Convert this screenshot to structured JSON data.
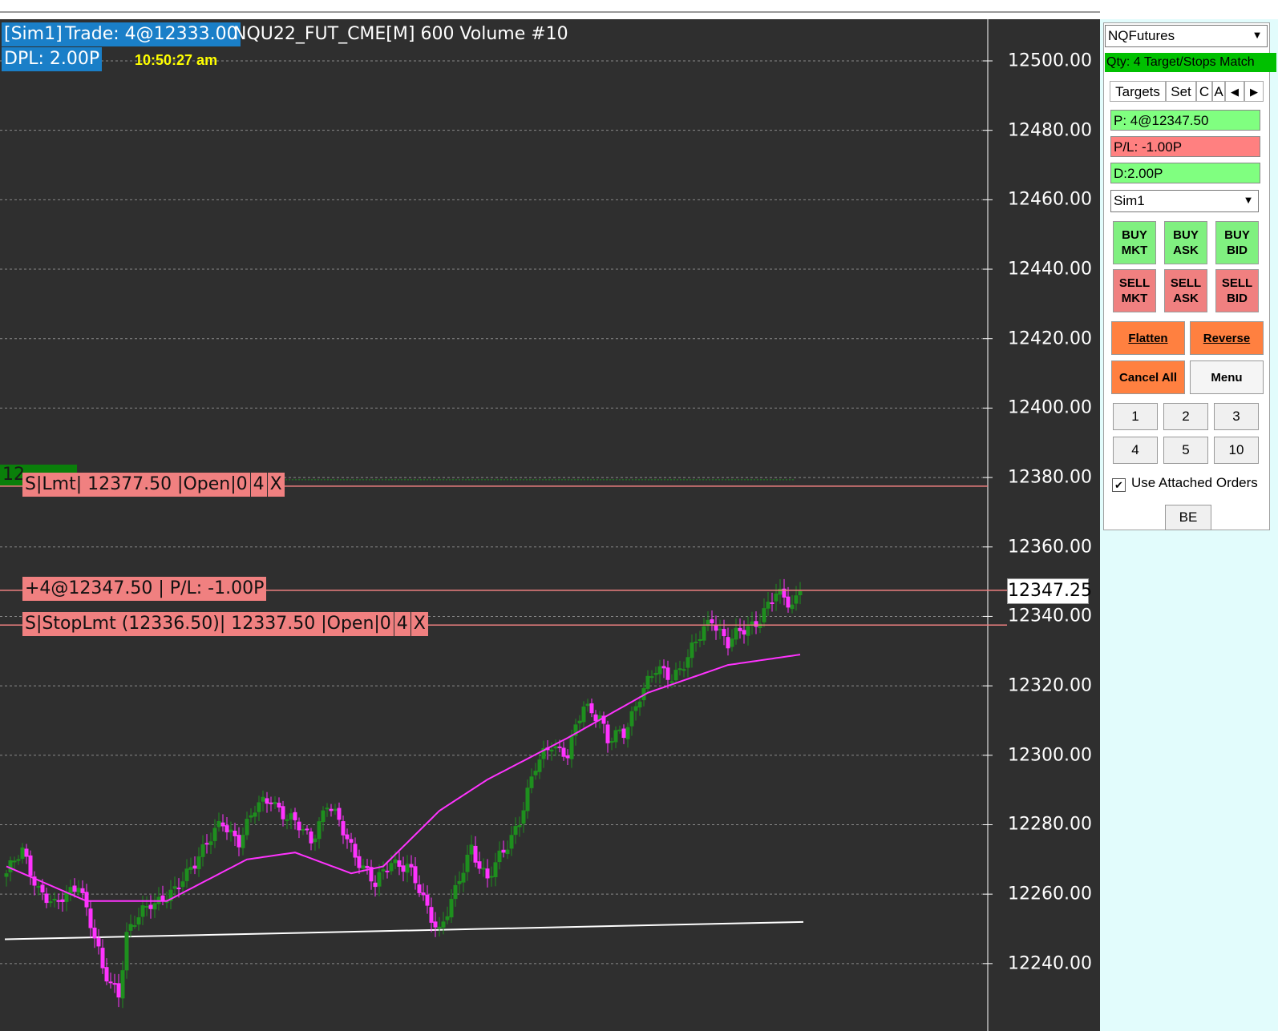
{
  "header": {
    "account": "[Sim1]",
    "trade": "Trade: 4@12333.00",
    "instrument_info": "NQU22_FUT_CME[M]  600 Volume  #10",
    "dpl": "DPL: 2.00P",
    "clock": "10:50:27 am"
  },
  "orders": {
    "limit_order": [
      "S|Lmt| 12377.50 |Open|0",
      "4",
      "X"
    ],
    "position": "+4@12347.50 | P/L: -1.00P",
    "stop_order": [
      "S|StopLmt (12336.50)| 12337.50 |Open|0",
      "4",
      "X"
    ],
    "truncated_marker": "12"
  },
  "axis": {
    "labels": [
      "12500.00",
      "12480.00",
      "12460.00",
      "12440.00",
      "12420.00",
      "12400.00",
      "12380.00",
      "12360.00",
      "12340.00",
      "12320.00",
      "12300.00",
      "12280.00",
      "12260.00",
      "12240.00"
    ],
    "last_price": "12347.25"
  },
  "panel": {
    "strategy": "NQFutures",
    "qty_status": "Qty: 4 Target/Stops Match",
    "tabs": [
      "Targets",
      "Set",
      "C",
      "A"
    ],
    "position_field": "P: 4@12347.50",
    "pl_field": "P/L: -1.00P",
    "d_field": "D:2.00P",
    "account": "Sim1",
    "buy_mkt": [
      "BUY",
      "MKT"
    ],
    "buy_ask": [
      "BUY",
      "ASK"
    ],
    "buy_bid": [
      "BUY",
      "BID"
    ],
    "sell_mkt": [
      "SELL",
      "MKT"
    ],
    "sell_ask": [
      "SELL",
      "ASK"
    ],
    "sell_bid": [
      "SELL",
      "BID"
    ],
    "flatten": "Flatten",
    "reverse": "Reverse",
    "cancel_all": "Cancel All",
    "menu": "Menu",
    "qty_buttons": [
      "1",
      "2",
      "3",
      "4",
      "5",
      "10"
    ],
    "use_attached_orders": "Use Attached Orders",
    "be": "BE"
  },
  "chart_data": {
    "type": "candlestick",
    "ylim": [
      12225,
      12515
    ],
    "grid": true,
    "gridlines": [
      12240,
      12260,
      12280,
      12300,
      12320,
      12340,
      12360,
      12380,
      12400,
      12420,
      12440,
      12460,
      12480,
      12500
    ],
    "order_lines": {
      "limit": 12377.5,
      "position": 12347.5,
      "stop": 12337.5
    },
    "colors": {
      "up": "#1e8f1e",
      "down": "#ff33ff",
      "ma": "#ff33ff",
      "trend": "#ffffff",
      "order_line": "#f08080",
      "background": "#2f2f2f"
    },
    "anchors": [
      [
        0,
        12266
      ],
      [
        4,
        12272
      ],
      [
        8,
        12262
      ],
      [
        12,
        12256
      ],
      [
        18,
        12264
      ],
      [
        24,
        12238
      ],
      [
        28,
        12232
      ],
      [
        30,
        12248
      ],
      [
        36,
        12258
      ],
      [
        42,
        12260
      ],
      [
        48,
        12272
      ],
      [
        54,
        12280
      ],
      [
        58,
        12276
      ],
      [
        62,
        12284
      ],
      [
        66,
        12288
      ],
      [
        70,
        12282
      ],
      [
        76,
        12276
      ],
      [
        80,
        12286
      ],
      [
        84,
        12278
      ],
      [
        88,
        12270
      ],
      [
        92,
        12262
      ],
      [
        96,
        12270
      ],
      [
        100,
        12268
      ],
      [
        104,
        12258
      ],
      [
        108,
        12250
      ],
      [
        112,
        12260
      ],
      [
        116,
        12274
      ],
      [
        120,
        12264
      ],
      [
        124,
        12272
      ],
      [
        128,
        12282
      ],
      [
        132,
        12296
      ],
      [
        136,
        12304
      ],
      [
        140,
        12300
      ],
      [
        144,
        12314
      ],
      [
        148,
        12312
      ],
      [
        150,
        12304
      ],
      [
        154,
        12306
      ],
      [
        158,
        12318
      ],
      [
        162,
        12324
      ],
      [
        166,
        12323
      ],
      [
        170,
        12328
      ],
      [
        174,
        12336
      ],
      [
        176,
        12340
      ],
      [
        180,
        12332
      ],
      [
        184,
        12336
      ],
      [
        188,
        12340
      ],
      [
        192,
        12346
      ],
      [
        196,
        12344
      ],
      [
        198,
        12347.25
      ]
    ],
    "ma_anchors": [
      [
        0,
        12268
      ],
      [
        20,
        12258
      ],
      [
        40,
        12258
      ],
      [
        60,
        12270
      ],
      [
        72,
        12272
      ],
      [
        86,
        12266
      ],
      [
        94,
        12268
      ],
      [
        108,
        12284
      ],
      [
        120,
        12293
      ],
      [
        140,
        12305
      ],
      [
        160,
        12318
      ],
      [
        180,
        12326
      ],
      [
        198,
        12329
      ]
    ],
    "trendline": [
      [
        0,
        12247
      ],
      [
        198,
        12252
      ]
    ]
  }
}
